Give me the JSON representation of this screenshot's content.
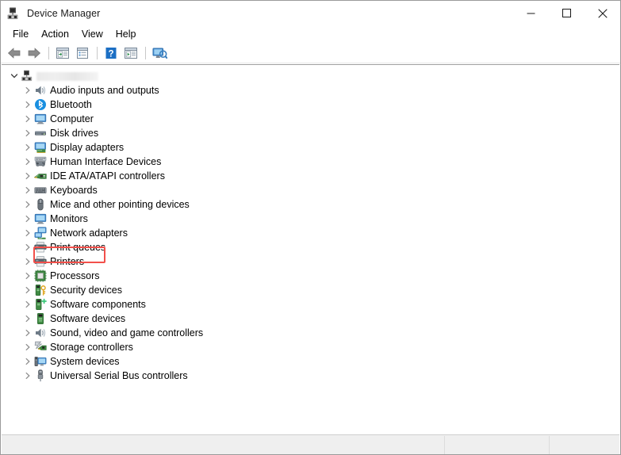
{
  "window": {
    "title": "Device Manager",
    "icon": "device-manager-icon",
    "controls": {
      "minimize_label": "—",
      "maximize_label": "❐",
      "close_label": "✕",
      "minimize_name": "minimize-button",
      "maximize_name": "maximize-button",
      "close_name": "close-button"
    }
  },
  "menubar": {
    "items": [
      {
        "label": "File",
        "name": "menu-file"
      },
      {
        "label": "Action",
        "name": "menu-action"
      },
      {
        "label": "View",
        "name": "menu-view"
      },
      {
        "label": "Help",
        "name": "menu-help"
      }
    ]
  },
  "toolbar": {
    "buttons": [
      {
        "name": "back-button",
        "icon": "back-arrow-icon",
        "tooltip": "Back"
      },
      {
        "name": "forward-button",
        "icon": "forward-arrow-icon",
        "tooltip": "Forward"
      },
      {
        "name": "show-hide-console-tree-button",
        "icon": "console-tree-icon",
        "tooltip": "Show/Hide Console Tree"
      },
      {
        "name": "properties-button",
        "icon": "properties-icon",
        "tooltip": "Properties"
      },
      {
        "name": "help-button",
        "icon": "help-question-icon",
        "tooltip": "Help"
      },
      {
        "name": "update-driver-button",
        "icon": "update-driver-icon",
        "tooltip": "Update Driver Software"
      },
      {
        "name": "scan-for-hardware-changes-button",
        "icon": "scan-hardware-icon",
        "tooltip": "Scan for hardware changes"
      }
    ]
  },
  "tree": {
    "root": {
      "name": "tree-root-computer",
      "label": "",
      "label_redacted": true,
      "icon": "computer-root-icon",
      "expanded": true
    },
    "items": [
      {
        "label": "Audio inputs and outputs",
        "icon": "speaker-icon",
        "name": "tree-item-audio-inputs-and-outputs"
      },
      {
        "label": "Bluetooth",
        "icon": "bluetooth-icon",
        "name": "tree-item-bluetooth"
      },
      {
        "label": "Computer",
        "icon": "monitor-icon",
        "name": "tree-item-computer"
      },
      {
        "label": "Disk drives",
        "icon": "disk-drive-icon",
        "name": "tree-item-disk-drives"
      },
      {
        "label": "Display adapters",
        "icon": "display-adapter-icon",
        "name": "tree-item-display-adapters"
      },
      {
        "label": "Human Interface Devices",
        "icon": "gamepad-icon",
        "name": "tree-item-human-interface-devices"
      },
      {
        "label": "IDE ATA/ATAPI controllers",
        "icon": "circuit-board-icon",
        "name": "tree-item-ide-ata-atapi-controllers"
      },
      {
        "label": "Keyboards",
        "icon": "keyboard-icon",
        "name": "tree-item-keyboards",
        "highlighted": true
      },
      {
        "label": "Mice and other pointing devices",
        "icon": "mouse-icon",
        "name": "tree-item-mice-and-other-pointing-devices"
      },
      {
        "label": "Monitors",
        "icon": "monitor-icon",
        "name": "tree-item-monitors"
      },
      {
        "label": "Network adapters",
        "icon": "network-adapter-icon",
        "name": "tree-item-network-adapters"
      },
      {
        "label": "Print queues",
        "icon": "printer-icon",
        "name": "tree-item-print-queues"
      },
      {
        "label": "Printers",
        "icon": "printer-icon",
        "name": "tree-item-printers"
      },
      {
        "label": "Processors",
        "icon": "processor-chip-icon",
        "name": "tree-item-processors"
      },
      {
        "label": "Security devices",
        "icon": "security-device-key-icon",
        "name": "tree-item-security-devices"
      },
      {
        "label": "Software components",
        "icon": "software-component-icon",
        "name": "tree-item-software-components"
      },
      {
        "label": "Software devices",
        "icon": "software-device-icon",
        "name": "tree-item-software-devices"
      },
      {
        "label": "Sound, video and game controllers",
        "icon": "speaker-icon",
        "name": "tree-item-sound-video-and-game-controllers"
      },
      {
        "label": "Storage controllers",
        "icon": "storage-controller-icon",
        "name": "tree-item-storage-controllers"
      },
      {
        "label": "System devices",
        "icon": "system-device-icon",
        "name": "tree-item-system-devices"
      },
      {
        "label": "Universal Serial Bus controllers",
        "icon": "usb-icon",
        "name": "tree-item-universal-serial-bus-controllers"
      }
    ]
  },
  "annotation": {
    "target": "Keyboards",
    "color": "#f2504b",
    "name": "keyboards-highlight-box"
  },
  "statusbar": {
    "panes": [
      {
        "text": "",
        "name": "status-pane-main"
      },
      {
        "text": "",
        "name": "status-pane-2"
      },
      {
        "text": "",
        "name": "status-pane-3"
      }
    ]
  },
  "colors": {
    "accent_highlight": "#f2504b",
    "window_bg": "#ffffff",
    "statusbar_bg": "#efefef",
    "text": "#000000",
    "bluetooth_blue": "#1a8fe0",
    "help_blue": "#1c6fc4"
  }
}
